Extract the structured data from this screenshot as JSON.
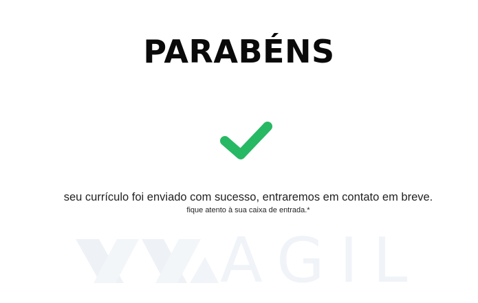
{
  "title": "PARABÉNS",
  "icons": {
    "success": "checkmark-icon",
    "watermark_logo": "brand-logo-mark"
  },
  "message": {
    "main": "seu currículo foi enviado com sucesso, entraremos em contato em breve.",
    "note": "fique atento à sua caixa de entrada.*"
  },
  "watermark": {
    "text": "AGIL"
  },
  "colors": {
    "accent_green": "#27b864",
    "title": "#0a0a0a",
    "watermark": "#f0f3f7"
  }
}
